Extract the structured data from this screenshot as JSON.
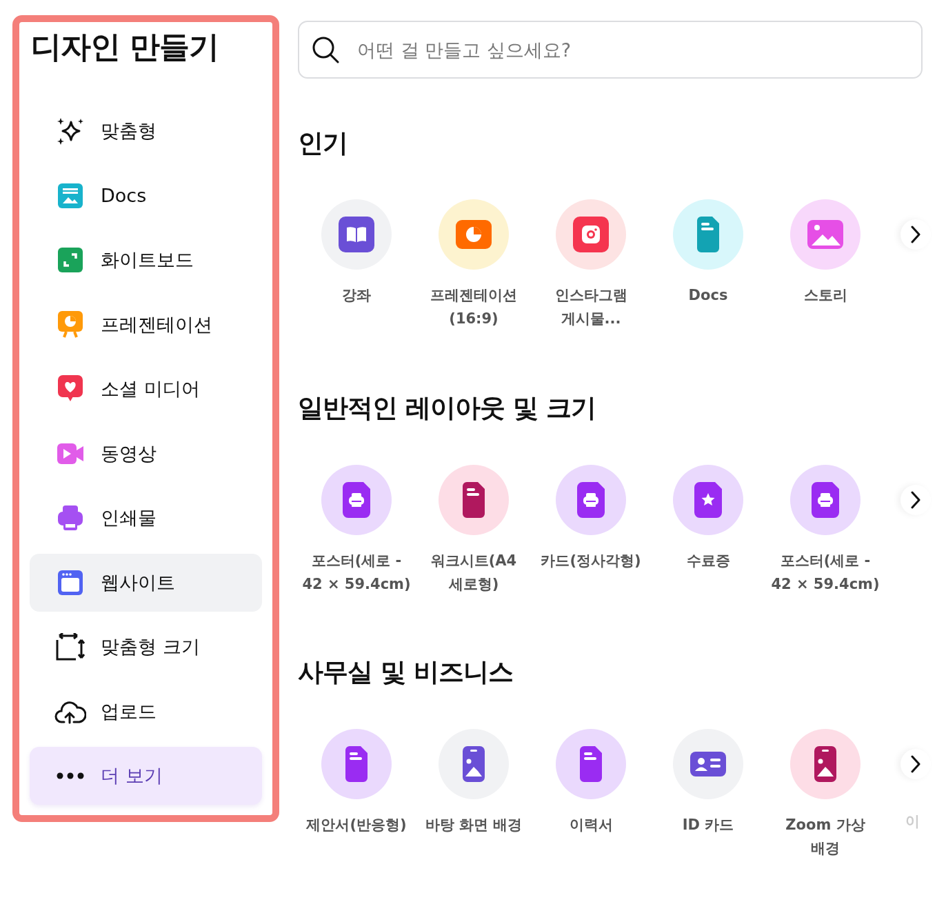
{
  "sidebar": {
    "title": "디자인 만들기",
    "items": [
      {
        "label": "맞춤형",
        "selected": false
      },
      {
        "label": "Docs",
        "selected": false
      },
      {
        "label": "화이트보드",
        "selected": false
      },
      {
        "label": "프레젠테이션",
        "selected": false
      },
      {
        "label": "소셜 미디어",
        "selected": false
      },
      {
        "label": "동영상",
        "selected": false
      },
      {
        "label": "인쇄물",
        "selected": false
      },
      {
        "label": "웹사이트",
        "selected": true
      },
      {
        "label": "맞춤형 크기",
        "selected": false
      },
      {
        "label": "업로드",
        "selected": false
      }
    ],
    "more": {
      "label": "더 보기"
    }
  },
  "search": {
    "placeholder": "어떤 걸 만들고 싶으세요?"
  },
  "sections": [
    {
      "title": "인기",
      "items": [
        {
          "label": "강좌"
        },
        {
          "label": "프레젠테이션\n(16:9)"
        },
        {
          "label": "인스타그램\n게시물..."
        },
        {
          "label": "Docs"
        },
        {
          "label": "스토리"
        }
      ]
    },
    {
      "title": "일반적인 레이아웃 및 크기",
      "items": [
        {
          "label": "포스터(세로 -\n42 × 59.4cm)"
        },
        {
          "label": "워크시트(A4\n세로형)"
        },
        {
          "label": "카드(정사각형)"
        },
        {
          "label": "수료증"
        },
        {
          "label": "포스터(세로 -\n42 × 59.4cm)"
        }
      ]
    },
    {
      "title": "사무실 및 비즈니스",
      "items": [
        {
          "label": "제안서(반응형)"
        },
        {
          "label": "바탕 화면 배경"
        },
        {
          "label": "이력서"
        },
        {
          "label": "ID 카드"
        },
        {
          "label": "Zoom 가상\n배경"
        }
      ],
      "partial_label": "이"
    }
  ]
}
